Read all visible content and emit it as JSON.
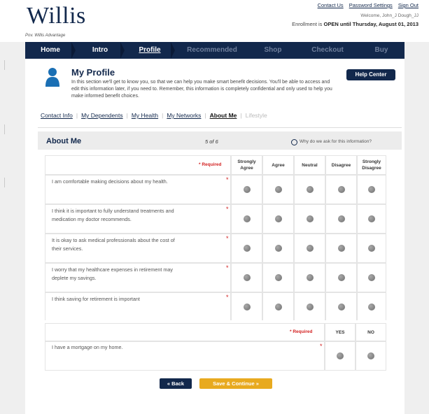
{
  "brand": {
    "logo": "Willis",
    "tagline": "Pov. Willis Advantage"
  },
  "top_links": [
    "Contact Us",
    "Password Settings",
    "Sign Out"
  ],
  "welcome": "Welcome, John_J Dough_JJ",
  "enrollment": {
    "prefix": "Enrollment is",
    "status": "OPEN",
    "middle": "until",
    "date": "Thursday, August 01, 2013"
  },
  "nav": {
    "tabs": [
      {
        "label": "Home",
        "state": "done"
      },
      {
        "label": "Intro",
        "state": "done"
      },
      {
        "label": "Profile",
        "state": "active"
      },
      {
        "label": "Recommended",
        "state": "future"
      },
      {
        "label": "Shop",
        "state": "future"
      },
      {
        "label": "Checkout",
        "state": "future"
      },
      {
        "label": "Buy",
        "state": "future"
      }
    ]
  },
  "profile": {
    "title": "My Profile",
    "description": "In this section we'll get to know you, so that we can help you make smart benefit decisions. You'll be able to access and edit this information later, if you need to. Remember, this information is completely confidential and only used to help you make informed benefit choices.",
    "help_label": "Help Center"
  },
  "subtabs": [
    {
      "label": "Contact Info",
      "state": "link"
    },
    {
      "label": "My Dependents",
      "state": "link"
    },
    {
      "label": "My Health",
      "state": "link"
    },
    {
      "label": "My Networks",
      "state": "link"
    },
    {
      "label": "About Me",
      "state": "active"
    },
    {
      "label": "Lifestyle",
      "state": "disabled"
    }
  ],
  "section": {
    "title": "About Me",
    "step": "5 of 6",
    "why": "Why do we ask for this information?"
  },
  "likert": {
    "required_label": "* Required",
    "columns": [
      "Strongly Agree",
      "Agree",
      "Neutral",
      "Disagree",
      "Strongly Disagree"
    ],
    "questions": [
      [
        "I am comfortable making decisions about my health."
      ],
      [
        "I think it is important to fully understand treatments and",
        "medication my doctor recommends."
      ],
      [
        "It is okay to ask medical professionals about the cost of",
        "their services."
      ],
      [
        "I worry that my healthcare expenses in retirement may",
        "deplete my savings."
      ],
      [
        "I think saving for retirement is important"
      ]
    ]
  },
  "yesno": {
    "required_label": "* Required",
    "columns": [
      "YES",
      "NO"
    ],
    "question": "I have a mortgage on my home."
  },
  "buttons": {
    "back": "« Back",
    "save": "Save & Continue »"
  },
  "colors": {
    "navy": "#12284c",
    "gold": "#e8aa1f",
    "required_red": "#d32222"
  }
}
